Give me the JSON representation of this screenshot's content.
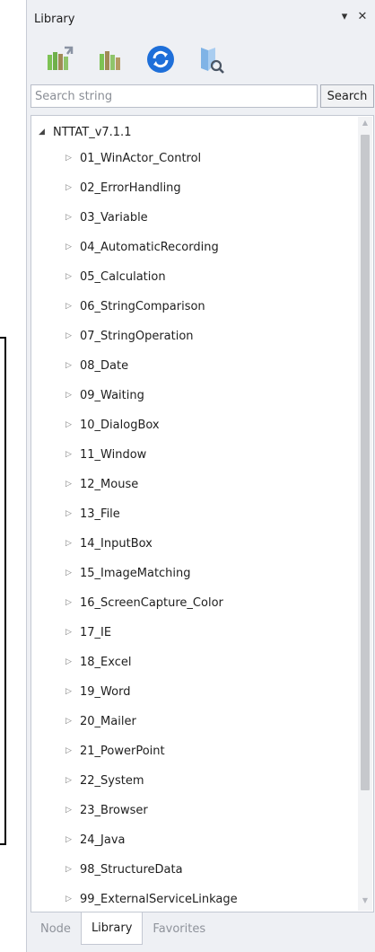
{
  "window": {
    "title": "Library",
    "dropdown_glyph": "▾",
    "close_glyph": "✕"
  },
  "toolbar": {
    "icons": [
      "books-add-icon",
      "books-icon",
      "refresh-icon",
      "book-search-icon"
    ],
    "colors": {
      "green": "#7dc254",
      "brown": "#a08a55",
      "blue": "#1e6fd9",
      "blue_light": "#7fb3e6"
    }
  },
  "search": {
    "placeholder": "Search string",
    "button_label": "Search"
  },
  "tree": {
    "root_label": "NTTAT_v7.1.1",
    "items": [
      "01_WinActor_Control",
      "02_ErrorHandling",
      "03_Variable",
      "04_AutomaticRecording",
      "05_Calculation",
      "06_StringComparison",
      "07_StringOperation",
      "08_Date",
      "09_Waiting",
      "10_DialogBox",
      "11_Window",
      "12_Mouse",
      "13_File",
      "14_InputBox",
      "15_ImageMatching",
      "16_ScreenCapture_Color",
      "17_IE",
      "18_Excel",
      "19_Word",
      "20_Mailer",
      "21_PowerPoint",
      "22_System",
      "23_Browser",
      "24_Java",
      "98_StructureData",
      "99_ExternalServiceLinkage"
    ]
  },
  "tabs": [
    {
      "label": "Node",
      "active": false
    },
    {
      "label": "Library",
      "active": true
    },
    {
      "label": "Favorites",
      "active": false
    }
  ]
}
